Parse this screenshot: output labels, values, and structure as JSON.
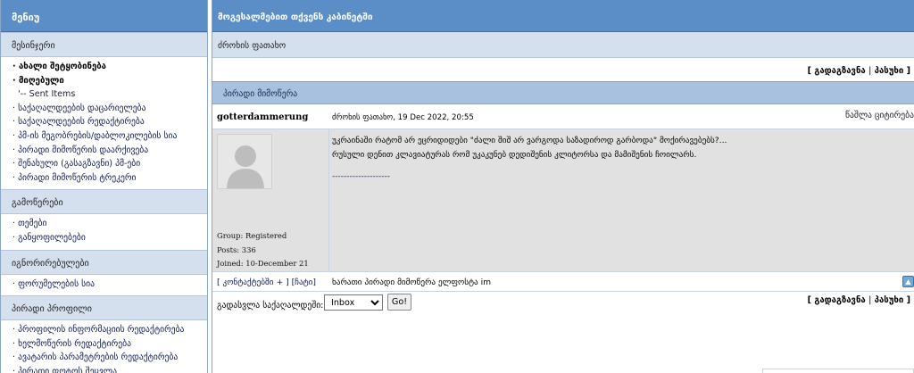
{
  "sidebar": {
    "title": "მენიუ",
    "sections": [
      {
        "title": "მესინჯერი",
        "items": [
          {
            "label": "· ახალი შეტყობინება",
            "bold": true
          },
          {
            "label": "· მიღებული",
            "bold": true
          },
          {
            "label": "'-- Sent Items",
            "sub": true
          },
          {
            "label": "· საქაღალდეების დაცარიელება"
          },
          {
            "label": "· საქაღალდეების რედაქტირება"
          },
          {
            "label": "· პმ-ის მეგობრების/დაბლოკილების სია"
          },
          {
            "label": "· პირადი მიმოწერის დაარქივება"
          },
          {
            "label": "· შენახული (გასაგზავნი) პმ-ები"
          },
          {
            "label": "· პირადი მიმოწერის ტრეკერი"
          }
        ]
      },
      {
        "title": "გამოწერები",
        "items": [
          {
            "label": "· თემები"
          },
          {
            "label": "· განყოფილებები"
          }
        ]
      },
      {
        "title": "იგნორირებულები",
        "items": [
          {
            "label": "· ფორუმელების სია"
          }
        ]
      },
      {
        "title": "პირადი პროფილი",
        "items": [
          {
            "label": "· პროფილის ინფორმაციის რედაქტირება"
          },
          {
            "label": "· ხელმოწერის რედაქტირება"
          },
          {
            "label": "· ავატარის პარამეტრების რედაქტირება"
          },
          {
            "label": "· პირადი ფოტოს შეცვლა"
          }
        ]
      }
    ]
  },
  "main": {
    "title": "მოგესალმებით თქვენს კაბინეტში",
    "subtitle": "ძროხის ფათახო",
    "actions": {
      "forward": "გადაგზავნა",
      "separator": "|",
      "reply": "პასუხი",
      "open_bracket": "[",
      "close_bracket": "]"
    },
    "pm_title": "პირადი მიმოწერა",
    "post": {
      "author": "gotterdammerung",
      "date": "ძროხის ფათახო, 19 Dec 2022, 20:55",
      "tools": "წაშლა  ციტირება",
      "avatar_icon": "default-avatar-icon",
      "author_group": "Group: Registered",
      "author_posts": "Posts: 336",
      "author_joined": "Joined: 10-December 21",
      "message_line1": "უკრაინაში რატომ არ ეცრიდიდები \"ძალი შიშ არ ვარგოდა საზადიროდ გარბოდა\" მოქირავებებს?...",
      "message_line2": "რუსული დენით კლავიატურას რომ უკაკუნებ დედიშენის კლიტორსა და მამიშენის ჩოილარს.",
      "signature": "--------------------",
      "footer_links": "[ კონტაქტებში + ] [ჩატი]",
      "footer_status": "ხარათი პირადი მიმოწერა ელფოსტა im",
      "top_icon": "scroll-top-icon"
    },
    "move": {
      "label": "გადასვლა საქაღალდეში:",
      "selected": "Inbox",
      "go_label": "Go!"
    }
  },
  "colors": {
    "header_blue": "#5b8dc6",
    "section_bg": "#d5e0ee",
    "pm_title_bg": "#a7c1df",
    "post_bg": "#e1e1e1"
  }
}
